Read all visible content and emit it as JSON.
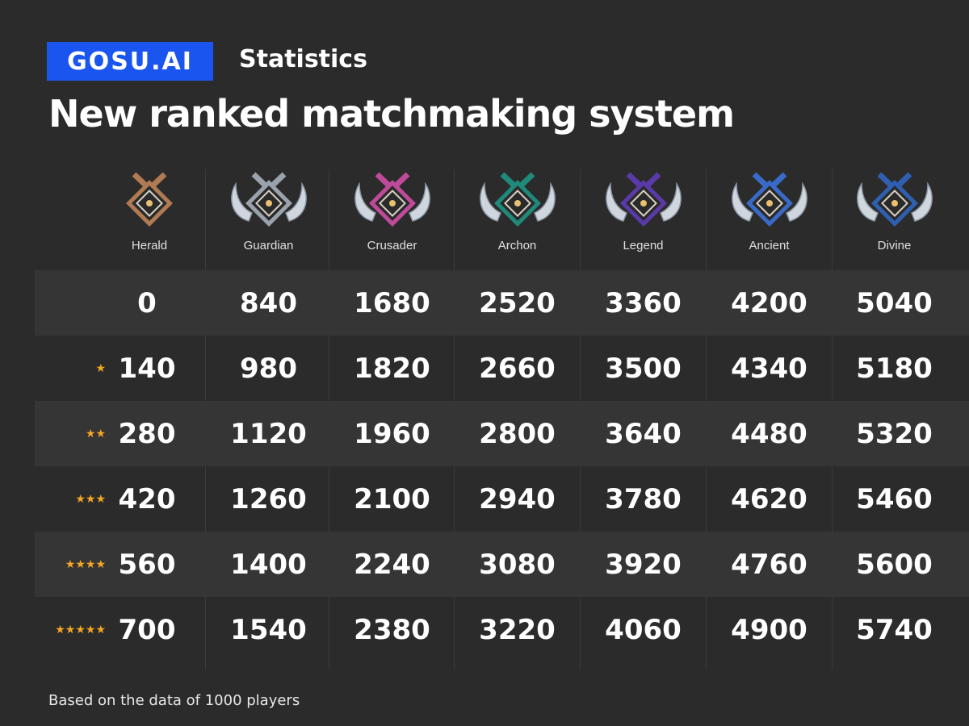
{
  "brand": {
    "logo_text": "GOSU.AI",
    "section": "Statistics"
  },
  "title": "New ranked matchmaking system",
  "footer": "Based on the data of 1000 players",
  "colors": {
    "logo_bg": "#1a55f0",
    "star": "#f5a623",
    "background": "#2b2b2b",
    "row_shade": "#353535"
  },
  "ranks": [
    {
      "name": "Herald",
      "icon": "herald-medal-icon",
      "accent": "#b07a52",
      "wings": false
    },
    {
      "name": "Guardian",
      "icon": "guardian-medal-icon",
      "accent": "#9aa3ad",
      "wings": true
    },
    {
      "name": "Crusader",
      "icon": "crusader-medal-icon",
      "accent": "#c04a9a",
      "wings": true
    },
    {
      "name": "Archon",
      "icon": "archon-medal-icon",
      "accent": "#1f8a7a",
      "wings": true
    },
    {
      "name": "Legend",
      "icon": "legend-medal-icon",
      "accent": "#5a3aa8",
      "wings": true
    },
    {
      "name": "Ancient",
      "icon": "ancient-medal-icon",
      "accent": "#3a6ac8",
      "wings": true
    },
    {
      "name": "Divine",
      "icon": "divine-medal-icon",
      "accent": "#2f5fb0",
      "wings": true
    }
  ],
  "rows": [
    {
      "stars": "",
      "values": [
        "0",
        "840",
        "1680",
        "2520",
        "3360",
        "4200",
        "5040"
      ]
    },
    {
      "stars": "★",
      "values": [
        "140",
        "980",
        "1820",
        "2660",
        "3500",
        "4340",
        "5180"
      ]
    },
    {
      "stars": "★★",
      "values": [
        "280",
        "1120",
        "1960",
        "2800",
        "3640",
        "4480",
        "5320"
      ]
    },
    {
      "stars": "★★★",
      "values": [
        "420",
        "1260",
        "2100",
        "2940",
        "3780",
        "4620",
        "5460"
      ]
    },
    {
      "stars": "★★★★",
      "values": [
        "560",
        "1400",
        "2240",
        "3080",
        "3920",
        "4760",
        "5600"
      ]
    },
    {
      "stars": "★★★★★",
      "values": [
        "700",
        "1540",
        "2380",
        "3220",
        "4060",
        "4900",
        "5740"
      ]
    }
  ]
}
